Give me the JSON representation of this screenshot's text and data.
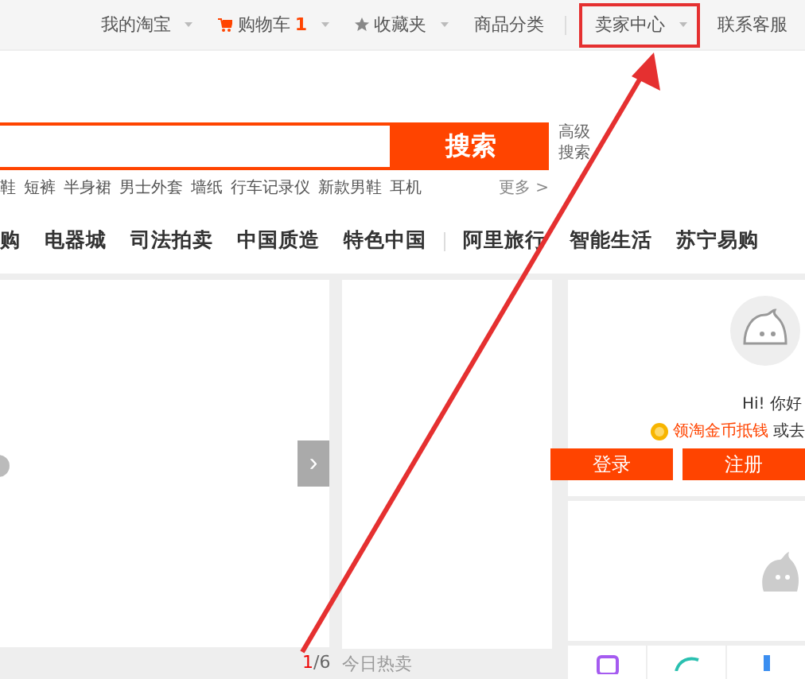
{
  "top_bar": {
    "links": [
      {
        "kind": "plain",
        "label": "我的淘宝",
        "dropdown": true,
        "highlighted": false
      },
      {
        "kind": "cart",
        "label": "购物车",
        "count": "1",
        "dropdown": true,
        "highlighted": false
      },
      {
        "kind": "star",
        "label": "收藏夹",
        "dropdown": true,
        "highlighted": false
      },
      {
        "kind": "plain",
        "label": "商品分类",
        "dropdown": false,
        "highlighted": false
      },
      {
        "kind": "plain",
        "label": "卖家中心",
        "dropdown": true,
        "highlighted": true
      },
      {
        "kind": "plain",
        "label": "联系客服",
        "dropdown": false,
        "highlighted": false
      }
    ]
  },
  "search": {
    "button": "搜索",
    "advanced": [
      "高级",
      "搜索"
    ]
  },
  "hot_words": [
    "鞋",
    "短裤",
    "半身裙",
    "男士外套",
    "墙纸",
    "行车记录仪",
    "新款男鞋",
    "耳机"
  ],
  "more": "更多 >",
  "nav": [
    "购",
    "电器城",
    "司法拍卖",
    "中国质造",
    "特色中国",
    "阿里旅行",
    "智能生活",
    "苏宁易购"
  ],
  "carousel": {
    "next": "›",
    "current": "1",
    "total": "/6"
  },
  "section_title": "今日热卖",
  "member": {
    "greeting": "Hi! 你好",
    "coin_link": "领淘金币抵钱",
    "coin_tail": "或去",
    "buttons": [
      "登录",
      "注册"
    ]
  }
}
